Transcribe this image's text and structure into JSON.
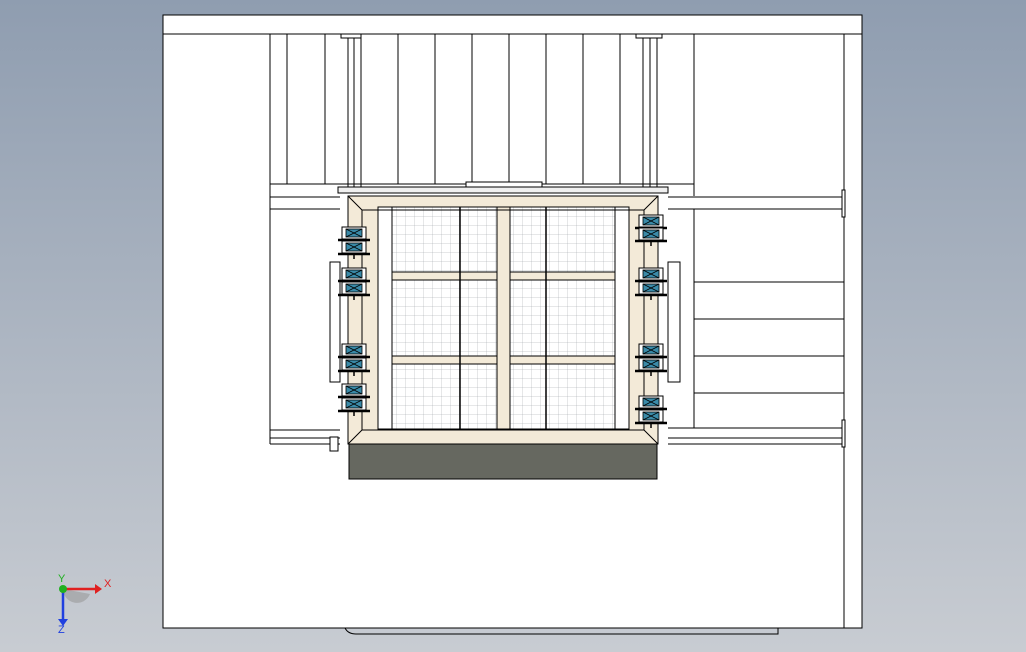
{
  "viewport": {
    "background_top": "#8f9db0",
    "background_bottom": "#c8ccd2",
    "sheet_color": "#ffffff",
    "line_color": "#000000",
    "frame_color": "#f3ead8",
    "base_block_color": "#666860",
    "clamp_accent_color": "#3a8aa8"
  },
  "triad": {
    "x_label": "X",
    "y_label": "Y",
    "z_label": "Z",
    "x_color": "#e02020",
    "y_color": "#20b020",
    "z_color": "#2040e0"
  }
}
